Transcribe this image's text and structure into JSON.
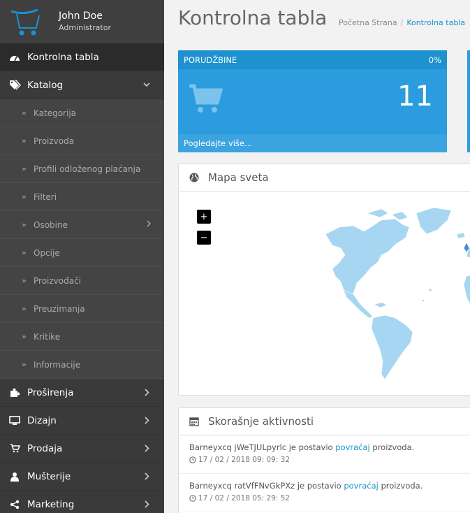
{
  "profile": {
    "name": "John Doe",
    "role": "Administrator"
  },
  "sidebar": {
    "items": [
      {
        "label": "Kontrolna tabla",
        "icon": "dashboard-icon"
      },
      {
        "label": "Katalog",
        "icon": "tags-icon"
      },
      {
        "label": "Proširenja",
        "icon": "puzzle-icon"
      },
      {
        "label": "Dizajn",
        "icon": "monitor-icon"
      },
      {
        "label": "Prodaja",
        "icon": "cart-icon"
      },
      {
        "label": "Mušterije",
        "icon": "user-icon"
      },
      {
        "label": "Marketing",
        "icon": "share-icon"
      }
    ],
    "catalog_sub": [
      "Kategorija",
      "Proizvoda",
      "Profili odloženog plaćanja",
      "Filteri",
      "Osobine",
      "Opcije",
      "Proizvođači",
      "Preuzimanja",
      "Kritike",
      "Informacije"
    ]
  },
  "header": {
    "title": "Kontrolna tabla",
    "breadcrumb": [
      "Početna Strana",
      "Kontrolna tabla"
    ]
  },
  "tile": {
    "title": "PORUDŽBINE",
    "percent": "0%",
    "value": "11",
    "footer": "Pogledajte više...",
    "color": "#2b9cdd"
  },
  "map": {
    "title": "Mapa sveta",
    "zoom_in": "+",
    "zoom_out": "−"
  },
  "activity": {
    "title": "Skorašnje aktivnosti",
    "items": [
      {
        "user": "Barneyxcq jWeTJULpyrlc",
        "pre": " je postavio ",
        "link": "povraćaj",
        "post": " proizvoda.",
        "time": "17 / 02 / 2018 09: 09: 32"
      },
      {
        "user": "Barneyxcq ratVfFNvGkPXz",
        "pre": " je postavio ",
        "link": "povraćaj",
        "post": " proizvoda.",
        "time": "17 / 02 / 2018 05: 29: 52"
      }
    ]
  }
}
